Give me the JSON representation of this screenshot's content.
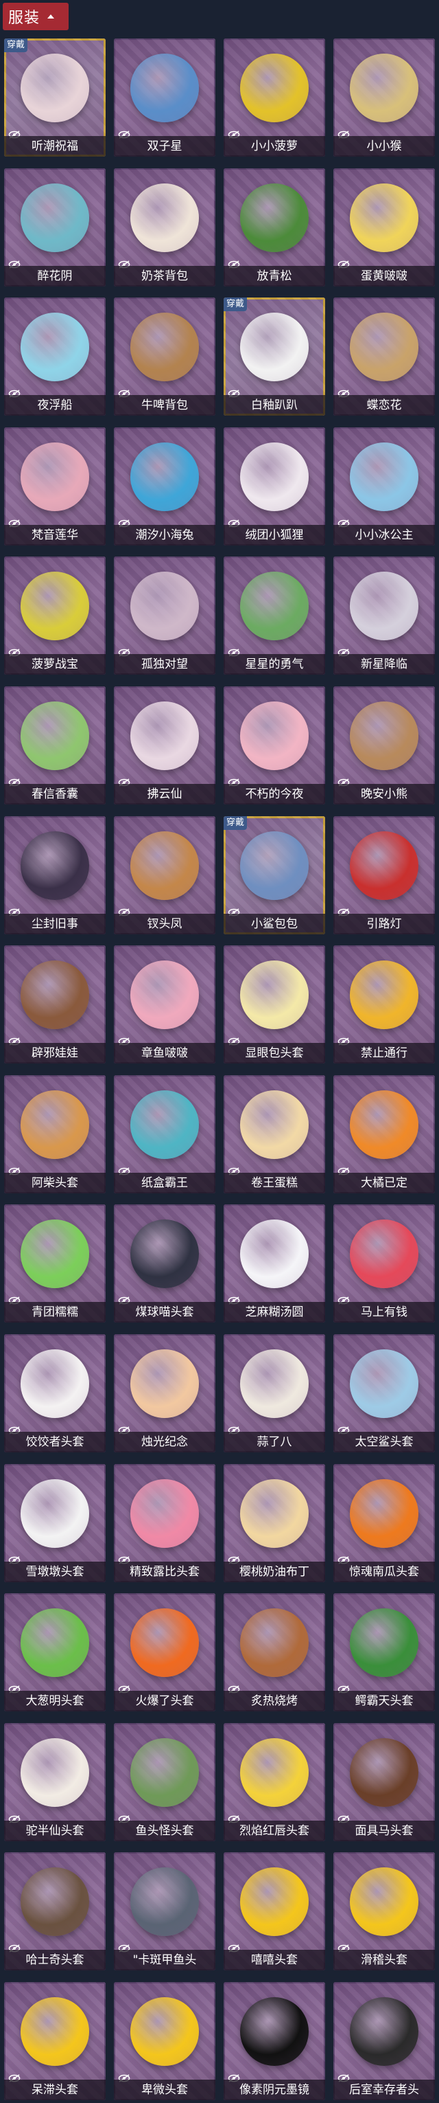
{
  "header": {
    "category_label": "服装"
  },
  "badge_text": "穿戴",
  "accent_gold": "#c9a23c",
  "accent_red": "#a52a33",
  "items": [
    {
      "name": "听潮祝福",
      "worn": true,
      "icon": "sparkle-ghost-icon",
      "color": "#e8d4d8"
    },
    {
      "name": "双子星",
      "worn": false,
      "icon": "globe-kid-icon",
      "color": "#5a8ec9"
    },
    {
      "name": "小小菠萝",
      "worn": false,
      "icon": "pineapple-icon",
      "color": "#e3c22a"
    },
    {
      "name": "小小猴",
      "worn": false,
      "icon": "monkey-icon",
      "color": "#d8c07a"
    },
    {
      "name": "醉花阴",
      "worn": false,
      "icon": "flower-ornament-icon",
      "color": "#6fb9c8"
    },
    {
      "name": "奶茶背包",
      "worn": false,
      "icon": "milk-tea-bag-icon",
      "color": "#efe4d8"
    },
    {
      "name": "放青松",
      "worn": false,
      "icon": "bonsai-icon",
      "color": "#4c8b3a"
    },
    {
      "name": "蛋黄啵啵",
      "worn": false,
      "icon": "chick-icon",
      "color": "#f0d45a"
    },
    {
      "name": "夜浮船",
      "worn": false,
      "icon": "jellyfish-icon",
      "color": "#8fd4e8"
    },
    {
      "name": "牛啤背包",
      "worn": false,
      "icon": "cow-barrel-icon",
      "color": "#b3834f"
    },
    {
      "name": "白釉趴趴",
      "worn": true,
      "icon": "panda-icon",
      "color": "#f2f2f2"
    },
    {
      "name": "蝶恋花",
      "worn": false,
      "icon": "pavilion-icon",
      "color": "#c9a36a"
    },
    {
      "name": "梵音莲华",
      "worn": false,
      "icon": "lotus-fairy-icon",
      "color": "#e7a9b9"
    },
    {
      "name": "潮汐小海兔",
      "worn": false,
      "icon": "sea-bunny-icon",
      "color": "#3fa6d8"
    },
    {
      "name": "绒团小狐狸",
      "worn": false,
      "icon": "fox-icon",
      "color": "#efe8ee"
    },
    {
      "name": "小小冰公主",
      "worn": false,
      "icon": "ice-princess-icon",
      "color": "#8cc6e6"
    },
    {
      "name": "菠萝战宝",
      "worn": false,
      "icon": "robot-icon",
      "color": "#d9cd3a"
    },
    {
      "name": "孤独对望",
      "worn": false,
      "icon": "couple-icon",
      "color": "#cfb8c9"
    },
    {
      "name": "星星的勇气",
      "worn": false,
      "icon": "planet-icon",
      "color": "#6cab62"
    },
    {
      "name": "新星降临",
      "worn": false,
      "icon": "angel-icon",
      "color": "#d5d0dc"
    },
    {
      "name": "春信香囊",
      "worn": false,
      "icon": "sachet-icon",
      "color": "#8fc66f"
    },
    {
      "name": "拂云仙",
      "worn": false,
      "icon": "fairy-icon",
      "color": "#e9d8e2"
    },
    {
      "name": "不朽的今夜",
      "worn": false,
      "icon": "cat-cup-icon",
      "color": "#f2b5c4"
    },
    {
      "name": "晚安小熊",
      "worn": false,
      "icon": "bear-icon",
      "color": "#b88a5c"
    },
    {
      "name": "尘封旧事",
      "worn": false,
      "icon": "boy-figure-icon",
      "color": "#3a3048"
    },
    {
      "name": "钗头凤",
      "worn": false,
      "icon": "phoenix-crown-icon",
      "color": "#c4874a"
    },
    {
      "name": "小鲨包包",
      "worn": true,
      "icon": "shark-icon",
      "color": "#6f8fc0"
    },
    {
      "name": "引路灯",
      "worn": false,
      "icon": "lantern-icon",
      "color": "#c9302e"
    },
    {
      "name": "辟邪娃娃",
      "worn": false,
      "icon": "doll-head-icon",
      "color": "#8a5a3c"
    },
    {
      "name": "章鱼啵啵",
      "worn": false,
      "icon": "octopus-icon",
      "color": "#f0a9bd"
    },
    {
      "name": "显眼包头套",
      "worn": false,
      "icon": "bulb-head-icon",
      "color": "#f4e9a8"
    },
    {
      "name": "禁止通行",
      "worn": false,
      "icon": "traffic-cone-icon",
      "color": "#f0b52b"
    },
    {
      "name": "阿柴头套",
      "worn": false,
      "icon": "shiba-icon",
      "color": "#d9984c"
    },
    {
      "name": "纸盒霸王",
      "worn": false,
      "icon": "dino-box-icon",
      "color": "#4fb5c4"
    },
    {
      "name": "卷王蛋糕",
      "worn": false,
      "icon": "cake-roll-icon",
      "color": "#f2d9a6"
    },
    {
      "name": "大橘已定",
      "worn": false,
      "icon": "orange-icon",
      "color": "#f08a28"
    },
    {
      "name": "青团糯糯",
      "worn": false,
      "icon": "green-rice-ball-icon",
      "color": "#7ccf5a"
    },
    {
      "name": "煤球喵头套",
      "worn": false,
      "icon": "black-cat-icon",
      "color": "#2f3242"
    },
    {
      "name": "芝麻糊汤圆",
      "worn": false,
      "icon": "dumpling-icon",
      "color": "#f5f5f8"
    },
    {
      "name": "马上有钱",
      "worn": false,
      "icon": "horse-head-icon",
      "color": "#e5495a"
    },
    {
      "name": "饺饺者头套",
      "worn": false,
      "icon": "cloud-dumpling-icon",
      "color": "#f4f2f2"
    },
    {
      "name": "烛光纪念",
      "worn": false,
      "icon": "candle-icon",
      "color": "#f2c8a0"
    },
    {
      "name": "蒜了八",
      "worn": false,
      "icon": "garlic-icon",
      "color": "#efe9df"
    },
    {
      "name": "太空鲨头套",
      "worn": false,
      "icon": "space-shark-icon",
      "color": "#9ecbe6"
    },
    {
      "name": "雪墩墩头套",
      "worn": false,
      "icon": "snowman-icon",
      "color": "#f3f3f3"
    },
    {
      "name": "精致露比头套",
      "worn": false,
      "icon": "loopy-icon",
      "color": "#f089a6"
    },
    {
      "name": "樱桃奶油布丁",
      "worn": false,
      "icon": "pudding-icon",
      "color": "#f2d7a0"
    },
    {
      "name": "惊魂南瓜头套",
      "worn": false,
      "icon": "pumpkin-icon",
      "color": "#ee7a1e"
    },
    {
      "name": "大葱明头套",
      "worn": false,
      "icon": "bok-choy-icon",
      "color": "#6bbf4a"
    },
    {
      "name": "火爆了头套",
      "worn": false,
      "icon": "fire-icon",
      "color": "#f06a20"
    },
    {
      "name": "炙热烧烤",
      "worn": false,
      "icon": "bbq-icon",
      "color": "#b06a3a"
    },
    {
      "name": "鳄霸天头套",
      "worn": false,
      "icon": "crocodile-icon",
      "color": "#3a8f3a"
    },
    {
      "name": "驼半仙头套",
      "worn": false,
      "icon": "alpaca-icon",
      "color": "#f2ece4"
    },
    {
      "name": "鱼头怪头套",
      "worn": false,
      "icon": "fish-head-icon",
      "color": "#6f9a58"
    },
    {
      "name": "烈焰红唇头套",
      "worn": false,
      "icon": "pikachu-icon",
      "color": "#f4d23a"
    },
    {
      "name": "面具马头套",
      "worn": false,
      "icon": "horse-mask-icon",
      "color": "#6a3f28"
    },
    {
      "name": "哈士奇头套",
      "worn": false,
      "icon": "husky-icon",
      "color": "#6a5240"
    },
    {
      "name": "\"卡斑甲鱼头",
      "worn": false,
      "icon": "seal-icon",
      "color": "#5a6474"
    },
    {
      "name": "嘻嘻头套",
      "worn": false,
      "icon": "grin-emoji-icon",
      "color": "#f4c61c"
    },
    {
      "name": "滑稽头套",
      "worn": false,
      "icon": "smirk-emoji-icon",
      "color": "#f4c61c"
    },
    {
      "name": "呆滞头套",
      "worn": false,
      "icon": "dazed-emoji-icon",
      "color": "#f4c61c"
    },
    {
      "name": "卑微头套",
      "worn": false,
      "icon": "sad-emoji-icon",
      "color": "#f4c61c"
    },
    {
      "name": "像素阴元墨镜",
      "worn": false,
      "icon": "pixel-sunglasses-icon",
      "color": "#111111"
    },
    {
      "name": "后室幸存者头",
      "worn": false,
      "icon": "gas-mask-icon",
      "color": "#2a2a2a"
    }
  ]
}
